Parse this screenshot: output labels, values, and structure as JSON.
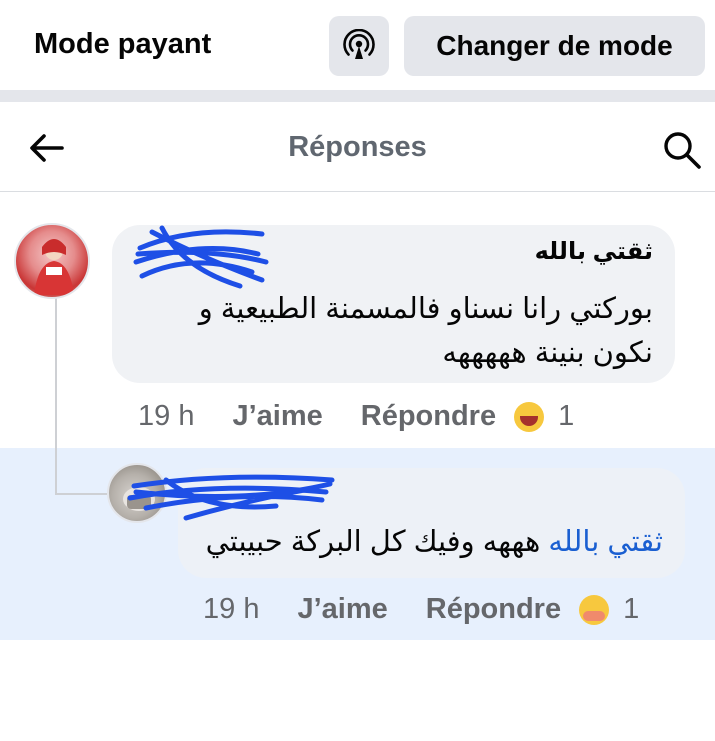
{
  "mode_bar": {
    "title": "Mode payant",
    "broadcast_icon": "broadcast-icon",
    "change_button": "Changer de mode"
  },
  "header": {
    "title": "Réponses",
    "back_icon": "arrow-left-icon",
    "search_icon": "search-icon"
  },
  "comments": [
    {
      "author": "ثقتي بالله",
      "text": "بوركتي رانا نسناو فالمسمنة الطبيعية و نكون بنينة هههههه",
      "time": "19 h",
      "like": "J’aime",
      "reply": "Répondre",
      "reaction_icon": "laughing-emoji-icon",
      "reaction_count": "1"
    },
    {
      "author": "",
      "mention": "ثقتي بالله",
      "text": " هههه وفيك كل البركة حبيبتي",
      "time": "19 h",
      "like": "J’aime",
      "reply": "Répondre",
      "reaction_icon": "hug-emoji-icon",
      "reaction_count": "1"
    }
  ],
  "colors": {
    "button_bg": "#e4e6eb",
    "bubble_bg": "#f0f2f5",
    "reply_highlight": "#e7f0fd",
    "mention": "#1a5fd1",
    "scribble": "#1e4fe6"
  }
}
